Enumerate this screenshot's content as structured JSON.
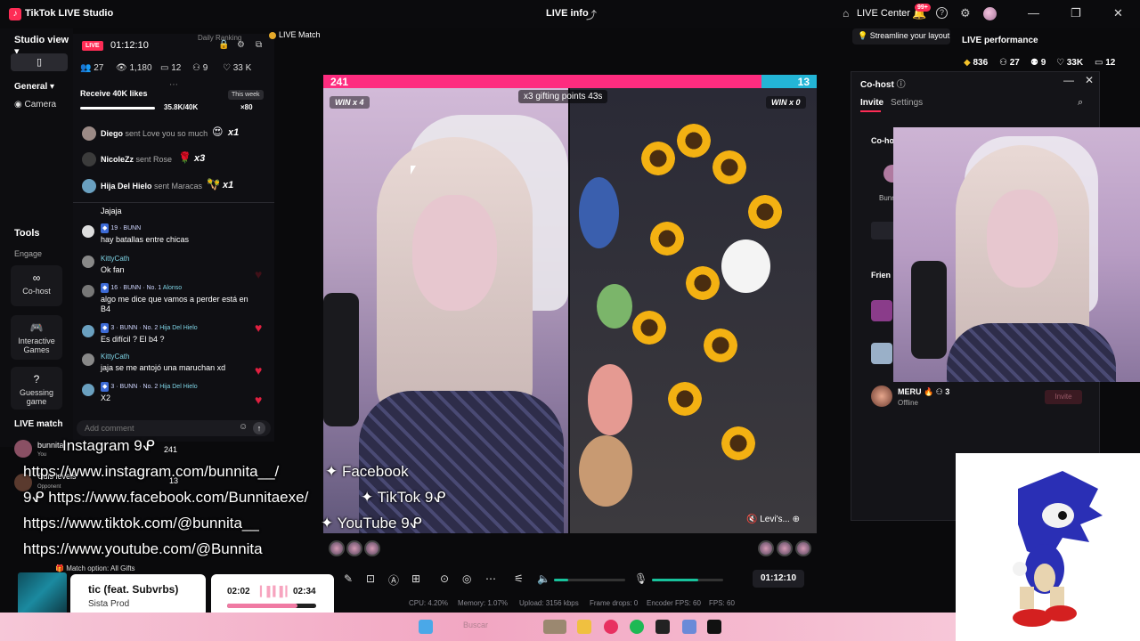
{
  "titlebar": {
    "app_title": "TikTok LIVE Studio",
    "center_title": "LIVE info",
    "live_center": "LIVE Center",
    "notif_badge": "99+",
    "window_controls": [
      "—",
      "❐",
      "✕"
    ]
  },
  "sidebar": {
    "studio_view": "Studio view",
    "general": "General",
    "camera": "Camera",
    "tools": "Tools",
    "engage": "Engage",
    "tiles": [
      {
        "icon": "∞",
        "label": "Co-host"
      },
      {
        "icon": "🎮",
        "label": "Interactive Games"
      },
      {
        "icon": "?",
        "label": "Guessing game"
      }
    ],
    "live_match": "LIVE match"
  },
  "chat": {
    "live_tag": "LIVE",
    "timer": "01:12:10",
    "daily_ranking": "Daily Ranking",
    "live_match_tag": "LIVE Match",
    "stats": [
      "27",
      "1,180",
      "12",
      "9",
      "33 K"
    ],
    "goal_title": "Receive 40K likes",
    "goal_period": "This week",
    "goal_progress": "35.8K/40K",
    "goal_multiplier": "×80",
    "gifts": [
      {
        "name": "Diego",
        "text": "sent Love you so much",
        "icon": "😍",
        "count": "x1"
      },
      {
        "name": "NicoleZz",
        "text": "sent Rose",
        "icon": "🌹",
        "count": "x3"
      },
      {
        "name": "Hija Del Hielo",
        "text": "sent Maracas",
        "icon": "🪇",
        "count": "x1"
      }
    ],
    "messages": [
      {
        "name": "",
        "text": "Jajaja"
      },
      {
        "name": "",
        "badges": "19 · BUNN",
        "text": "hay batallas entre chicas"
      },
      {
        "name": "KittyCath",
        "text": "Ok fan"
      },
      {
        "name": "Alonso",
        "badges": "16 · BUNN · No. 1",
        "text": "algo me dice que vamos a perder está en",
        "text2": "B4"
      },
      {
        "name": "Hija Del Hielo",
        "badges": "3 · BUNN · No. 2",
        "text": "Es difícil ? El b4 ?"
      },
      {
        "name": "KittyCath",
        "text": "jaja se me antojó una maruchan xd"
      },
      {
        "name": "Hija Del Hielo",
        "badges": "3 · BUNN · No. 2",
        "text": "X2"
      }
    ],
    "input_placeholder": "Add comment"
  },
  "battle": {
    "left_score": "241",
    "right_score": "13",
    "left_win": "WIN x 4",
    "right_win": "WIN x 0",
    "gifting": "x3 gifting points  43s",
    "opponent_label": "Levi's..."
  },
  "socials": {
    "instagram_label": "Instagram 9ᕵ",
    "instagram_url": "https://www.instagram.com/bunnita__/",
    "facebook_label": "✦ Facebook",
    "facebook_url": "9ᕵ https://www.facebook.com/Bunnitaexe/",
    "tiktok_label": "✦ TikTok 9ᕵ",
    "tiktok_url": "https://www.tiktok.com/@bunnita__",
    "youtube_label": "✦ YouTube 9ᕵ",
    "youtube_url": "https://www.youtube.com/@Bunnita"
  },
  "live_match_panel": {
    "user1": "bunnita",
    "user1_sub": "You",
    "user1_score": "241",
    "user2": "Cuis leveis",
    "user2_sub": "Opponent",
    "user2_score": "13"
  },
  "controls": {
    "timer": "01:12:10",
    "mic_volume": 0.65,
    "speaker_volume": 0.2,
    "stats": {
      "cpu": "CPU: 4.20%",
      "memory": "Memory: 1.07%",
      "upload": "Upload: 3156 kbps",
      "frame_drops": "Frame drops: 0",
      "encoder_fps": "Encoder FPS: 60",
      "fps": "FPS: 60"
    }
  },
  "right": {
    "streamline": "Streamline your layout",
    "perf_title": "LIVE performance",
    "perf": [
      "836",
      "27",
      "9",
      "33K",
      "12"
    ],
    "cohost_title": "Co-host",
    "tabs": [
      "Invite",
      "Settings"
    ],
    "section_cohost": "Co-ho",
    "section_friends": "Frien",
    "user_name": "MERU",
    "user_count": "3",
    "user_status": "Offline",
    "invite_btn": "Invite",
    "bunni": "Bunni"
  },
  "music": {
    "title": "tic (feat. Subvrbs)",
    "artist": "Sista Prod",
    "elapsed": "02:02",
    "duration": "02:34",
    "progress": 0.79,
    "match_option": "Match option: All Gifts"
  },
  "taskbar": {
    "search": "Buscar"
  }
}
